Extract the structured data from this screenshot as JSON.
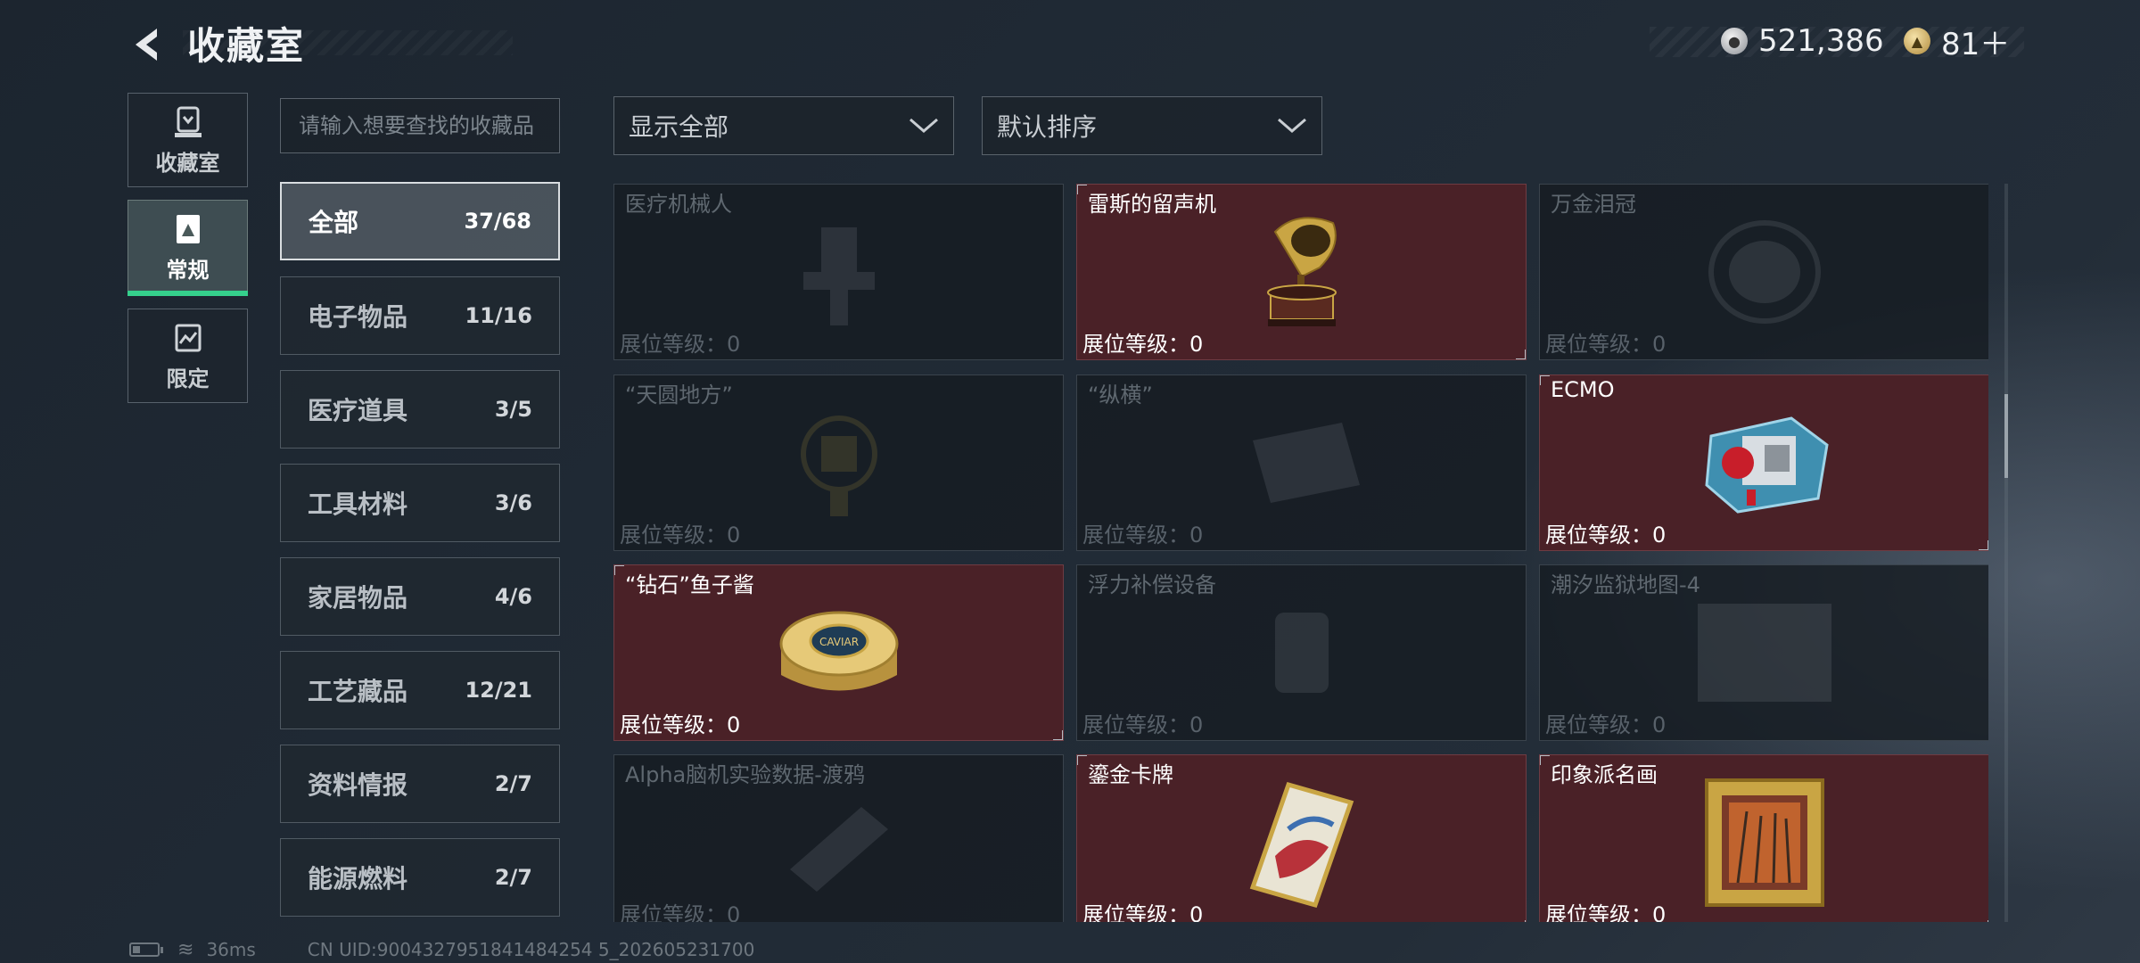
{
  "header": {
    "title": "收藏室",
    "currency": [
      {
        "icon": "silver-coin-icon",
        "value": "521,386"
      },
      {
        "icon": "gold-coin-icon",
        "value": "81＋"
      }
    ]
  },
  "nav_tabs": [
    {
      "label": "收藏室",
      "icon": "collection-room-icon"
    },
    {
      "label": "常规",
      "icon": "regular-card-icon",
      "active": true
    },
    {
      "label": "限定",
      "icon": "limited-card-icon"
    }
  ],
  "search": {
    "placeholder": "请输入想要查找的收藏品"
  },
  "categories": [
    {
      "name": "全部",
      "count": "37/68",
      "active": true
    },
    {
      "name": "电子物品",
      "count": "11/16"
    },
    {
      "name": "医疗道具",
      "count": "3/5"
    },
    {
      "name": "工具材料",
      "count": "3/6"
    },
    {
      "name": "家居物品",
      "count": "4/6"
    },
    {
      "name": "工艺藏品",
      "count": "12/21"
    },
    {
      "name": "资料情报",
      "count": "2/7"
    },
    {
      "name": "能源燃料",
      "count": "2/7"
    }
  ],
  "filters": {
    "display": "显示全部",
    "sort": "默认排序"
  },
  "level_label": "展位等级：0",
  "items": [
    {
      "name": "医疗机械人",
      "owned": false,
      "icon": "medical-robot-icon"
    },
    {
      "name": "雷斯的留声机",
      "owned": true,
      "icon": "gramophone-icon"
    },
    {
      "name": "万金泪冠",
      "owned": false,
      "icon": "tiara-icon"
    },
    {
      "name": "“天圆地方”",
      "owned": false,
      "icon": "round-square-artifact-icon"
    },
    {
      "name": "“纵横”",
      "owned": false,
      "icon": "chessboard-icon"
    },
    {
      "name": "ECMO",
      "owned": true,
      "icon": "ecmo-machine-icon"
    },
    {
      "name": "“钻石”鱼子酱",
      "owned": true,
      "icon": "caviar-tin-icon"
    },
    {
      "name": "浮力补偿设备",
      "owned": false,
      "icon": "buoyancy-device-icon"
    },
    {
      "name": "潮汐监狱地图-4",
      "owned": false,
      "icon": "map-icon"
    },
    {
      "name": "Alpha脑机实验数据-渡鸦",
      "owned": false,
      "icon": "data-drive-icon"
    },
    {
      "name": "鎏金卡牌",
      "owned": true,
      "icon": "gilded-card-icon"
    },
    {
      "name": "印象派名画",
      "owned": true,
      "icon": "framed-painting-icon"
    }
  ],
  "footer": {
    "ping": "36ms",
    "uid": "CN UID:9004327951841484254 5_202605231700"
  },
  "colors": {
    "owned_card": "#4a2127",
    "locked_card": "#161c22",
    "active_tab_accent": "#35d08c"
  }
}
